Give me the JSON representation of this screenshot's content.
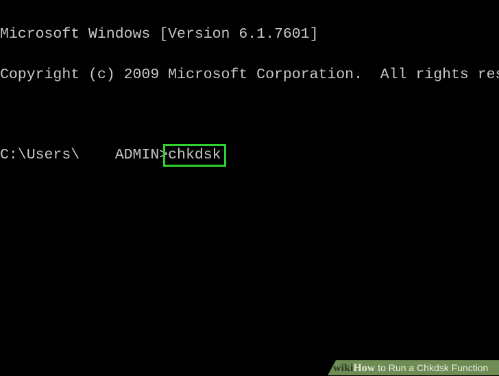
{
  "terminal": {
    "lines": [
      "Microsoft Windows [Version 6.1.7601]",
      "Copyright (c) 2009 Microsoft Corporation.  All rights res",
      ""
    ],
    "prompt": "C:\\Users\\    ADMIN>",
    "command": "chkdsk"
  },
  "highlight_color": "#2fd12f",
  "watermark": {
    "wiki": "wiki",
    "how": "How",
    "title": " to Run a Chkdsk Function"
  }
}
